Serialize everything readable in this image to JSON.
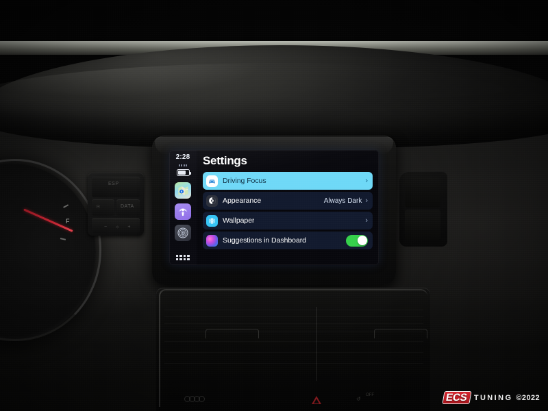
{
  "scene": {
    "description": "Apple CarPlay Settings screen shown on a car head unit display in a dark vehicle dashboard"
  },
  "carplay": {
    "status": {
      "time": "2:28",
      "battery_icon": "battery-icon",
      "signal_icon": "signal-dots-icon"
    },
    "sidebar": {
      "apps": [
        {
          "name": "maps-app-icon",
          "label": "Maps"
        },
        {
          "name": "podcasts-app-icon",
          "label": "Podcasts"
        },
        {
          "name": "discover-app-icon",
          "label": "Discover"
        }
      ],
      "grid_button": "app-grid-button"
    },
    "header": {
      "title": "Settings"
    },
    "rows": [
      {
        "id": "driving-focus",
        "label": "Driving Focus",
        "icon": "car-icon",
        "value": "",
        "accessory": "chevron",
        "chevron": "›",
        "selected": true
      },
      {
        "id": "appearance",
        "label": "Appearance",
        "icon": "contrast-circle-icon",
        "value": "Always Dark",
        "accessory": "chevron",
        "chevron": "›",
        "selected": false
      },
      {
        "id": "wallpaper",
        "label": "Wallpaper",
        "icon": "wallpaper-flower-icon",
        "value": "",
        "accessory": "chevron",
        "chevron": "›",
        "selected": false
      },
      {
        "id": "suggestions-in-dashboard",
        "label": "Suggestions in Dashboard",
        "icon": "siri-orb-icon",
        "value": "",
        "accessory": "toggle",
        "toggle_on": true,
        "selected": false
      }
    ],
    "colors": {
      "selected_row": "#6ed8f7",
      "row_background": "#121a2e",
      "toggle_on": "#35d04b",
      "screen_background": "#07070c",
      "title_text": "#ffffff"
    }
  },
  "dashboard": {
    "left_pod_glyphs": [
      "ESP",
      "DATA",
      "⌘"
    ],
    "hvac_glyphs": [
      "OFF"
    ],
    "hazard_button": "hazard-triangle-button",
    "audi_rings": "four-rings-badge"
  },
  "watermark": {
    "brand": "ECS",
    "tuning": "TUNING",
    "copyright": "©2022"
  }
}
